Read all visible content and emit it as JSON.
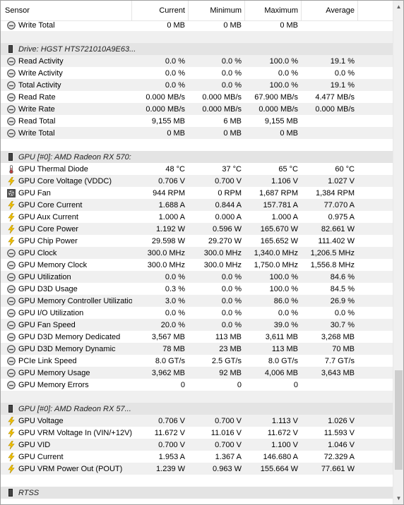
{
  "columns": {
    "sensor": "Sensor",
    "current": "Current",
    "minimum": "Minimum",
    "maximum": "Maximum",
    "average": "Average"
  },
  "rows": [
    {
      "kind": "sensor",
      "icon": "gauge-icon",
      "name": "Write Total",
      "cur": "0 MB",
      "min": "0 MB",
      "max": "0 MB",
      "avg": ""
    },
    {
      "kind": "spacer"
    },
    {
      "kind": "group",
      "name": "Drive: HGST HTS721010A9E63..."
    },
    {
      "kind": "sensor",
      "icon": "gauge-icon",
      "name": "Read Activity",
      "cur": "0.0 %",
      "min": "0.0 %",
      "max": "100.0 %",
      "avg": "19.1 %"
    },
    {
      "kind": "sensor",
      "icon": "gauge-icon",
      "name": "Write Activity",
      "cur": "0.0 %",
      "min": "0.0 %",
      "max": "0.0 %",
      "avg": "0.0 %"
    },
    {
      "kind": "sensor",
      "icon": "gauge-icon",
      "name": "Total Activity",
      "cur": "0.0 %",
      "min": "0.0 %",
      "max": "100.0 %",
      "avg": "19.1 %"
    },
    {
      "kind": "sensor",
      "icon": "gauge-icon",
      "name": "Read Rate",
      "cur": "0.000 MB/s",
      "min": "0.000 MB/s",
      "max": "67.900 MB/s",
      "avg": "4.477 MB/s"
    },
    {
      "kind": "sensor",
      "icon": "gauge-icon",
      "name": "Write Rate",
      "cur": "0.000 MB/s",
      "min": "0.000 MB/s",
      "max": "0.000 MB/s",
      "avg": "0.000 MB/s"
    },
    {
      "kind": "sensor",
      "icon": "gauge-icon",
      "name": "Read Total",
      "cur": "9,155 MB",
      "min": "6 MB",
      "max": "9,155 MB",
      "avg": ""
    },
    {
      "kind": "sensor",
      "icon": "gauge-icon",
      "name": "Write Total",
      "cur": "0 MB",
      "min": "0 MB",
      "max": "0 MB",
      "avg": ""
    },
    {
      "kind": "spacer"
    },
    {
      "kind": "group",
      "name": "GPU [#0]: AMD Radeon RX 570:"
    },
    {
      "kind": "sensor",
      "icon": "thermometer-icon",
      "name": "GPU Thermal Diode",
      "cur": "48 °C",
      "min": "37 °C",
      "max": "65 °C",
      "avg": "60 °C"
    },
    {
      "kind": "sensor",
      "icon": "lightning-icon",
      "name": "GPU Core Voltage (VDDC)",
      "cur": "0.706 V",
      "min": "0.700 V",
      "max": "1.106 V",
      "avg": "1.027 V"
    },
    {
      "kind": "sensor",
      "icon": "fan-icon",
      "name": "GPU Fan",
      "cur": "944 RPM",
      "min": "0 RPM",
      "max": "1,687 RPM",
      "avg": "1,384 RPM"
    },
    {
      "kind": "sensor",
      "icon": "lightning-icon",
      "name": "GPU Core Current",
      "cur": "1.688 A",
      "min": "0.844 A",
      "max": "157.781 A",
      "avg": "77.070 A"
    },
    {
      "kind": "sensor",
      "icon": "lightning-icon",
      "name": "GPU Aux Current",
      "cur": "1.000 A",
      "min": "0.000 A",
      "max": "1.000 A",
      "avg": "0.975 A"
    },
    {
      "kind": "sensor",
      "icon": "lightning-icon",
      "name": "GPU Core Power",
      "cur": "1.192 W",
      "min": "0.596 W",
      "max": "165.670 W",
      "avg": "82.661 W"
    },
    {
      "kind": "sensor",
      "icon": "lightning-icon",
      "name": "GPU Chip Power",
      "cur": "29.598 W",
      "min": "29.270 W",
      "max": "165.652 W",
      "avg": "111.402 W"
    },
    {
      "kind": "sensor",
      "icon": "gauge-icon",
      "name": "GPU Clock",
      "cur": "300.0 MHz",
      "min": "300.0 MHz",
      "max": "1,340.0 MHz",
      "avg": "1,206.5 MHz"
    },
    {
      "kind": "sensor",
      "icon": "gauge-icon",
      "name": "GPU Memory Clock",
      "cur": "300.0 MHz",
      "min": "300.0 MHz",
      "max": "1,750.0 MHz",
      "avg": "1,556.8 MHz"
    },
    {
      "kind": "sensor",
      "icon": "gauge-icon",
      "name": "GPU Utilization",
      "cur": "0.0 %",
      "min": "0.0 %",
      "max": "100.0 %",
      "avg": "84.6 %"
    },
    {
      "kind": "sensor",
      "icon": "gauge-icon",
      "name": "GPU D3D Usage",
      "cur": "0.3 %",
      "min": "0.0 %",
      "max": "100.0 %",
      "avg": "84.5 %"
    },
    {
      "kind": "sensor",
      "icon": "gauge-icon",
      "name": "GPU Memory Controller Utilization",
      "cur": "3.0 %",
      "min": "0.0 %",
      "max": "86.0 %",
      "avg": "26.9 %"
    },
    {
      "kind": "sensor",
      "icon": "gauge-icon",
      "name": "GPU I/O Utilization",
      "cur": "0.0 %",
      "min": "0.0 %",
      "max": "0.0 %",
      "avg": "0.0 %"
    },
    {
      "kind": "sensor",
      "icon": "gauge-icon",
      "name": "GPU Fan Speed",
      "cur": "20.0 %",
      "min": "0.0 %",
      "max": "39.0 %",
      "avg": "30.7 %"
    },
    {
      "kind": "sensor",
      "icon": "gauge-icon",
      "name": "GPU D3D Memory Dedicated",
      "cur": "3,567 MB",
      "min": "113 MB",
      "max": "3,611 MB",
      "avg": "3,268 MB"
    },
    {
      "kind": "sensor",
      "icon": "gauge-icon",
      "name": "GPU D3D Memory Dynamic",
      "cur": "78 MB",
      "min": "23 MB",
      "max": "113 MB",
      "avg": "70 MB"
    },
    {
      "kind": "sensor",
      "icon": "gauge-icon",
      "name": "PCIe Link Speed",
      "cur": "8.0 GT/s",
      "min": "2.5 GT/s",
      "max": "8.0 GT/s",
      "avg": "7.7 GT/s"
    },
    {
      "kind": "sensor",
      "icon": "gauge-icon",
      "name": "GPU Memory Usage",
      "cur": "3,962 MB",
      "min": "92 MB",
      "max": "4,006 MB",
      "avg": "3,643 MB"
    },
    {
      "kind": "sensor",
      "icon": "gauge-icon",
      "name": "GPU Memory Errors",
      "cur": "0",
      "min": "0",
      "max": "0",
      "avg": ""
    },
    {
      "kind": "spacer"
    },
    {
      "kind": "group",
      "name": "GPU [#0]: AMD Radeon RX 57..."
    },
    {
      "kind": "sensor",
      "icon": "lightning-icon",
      "name": "GPU Voltage",
      "cur": "0.706 V",
      "min": "0.700 V",
      "max": "1.113 V",
      "avg": "1.026 V"
    },
    {
      "kind": "sensor",
      "icon": "lightning-icon",
      "name": "GPU VRM Voltage In (VIN/+12V)",
      "cur": "11.672 V",
      "min": "11.016 V",
      "max": "11.672 V",
      "avg": "11.593 V"
    },
    {
      "kind": "sensor",
      "icon": "lightning-icon",
      "name": "GPU VID",
      "cur": "0.700 V",
      "min": "0.700 V",
      "max": "1.100 V",
      "avg": "1.046 V"
    },
    {
      "kind": "sensor",
      "icon": "lightning-icon",
      "name": "GPU Current",
      "cur": "1.953 A",
      "min": "1.367 A",
      "max": "146.680 A",
      "avg": "72.329 A"
    },
    {
      "kind": "sensor",
      "icon": "lightning-icon",
      "name": "GPU VRM Power Out (POUT)",
      "cur": "1.239 W",
      "min": "0.963 W",
      "max": "155.664 W",
      "avg": "77.661 W"
    },
    {
      "kind": "spacer"
    },
    {
      "kind": "group",
      "name": "RTSS"
    }
  ],
  "colors": {
    "stripe": "#f0f0f0",
    "group": "#e4e4e4",
    "lightning": "#f2c200",
    "gauge": "#4a4a4a"
  },
  "scroll_position": 0.83
}
